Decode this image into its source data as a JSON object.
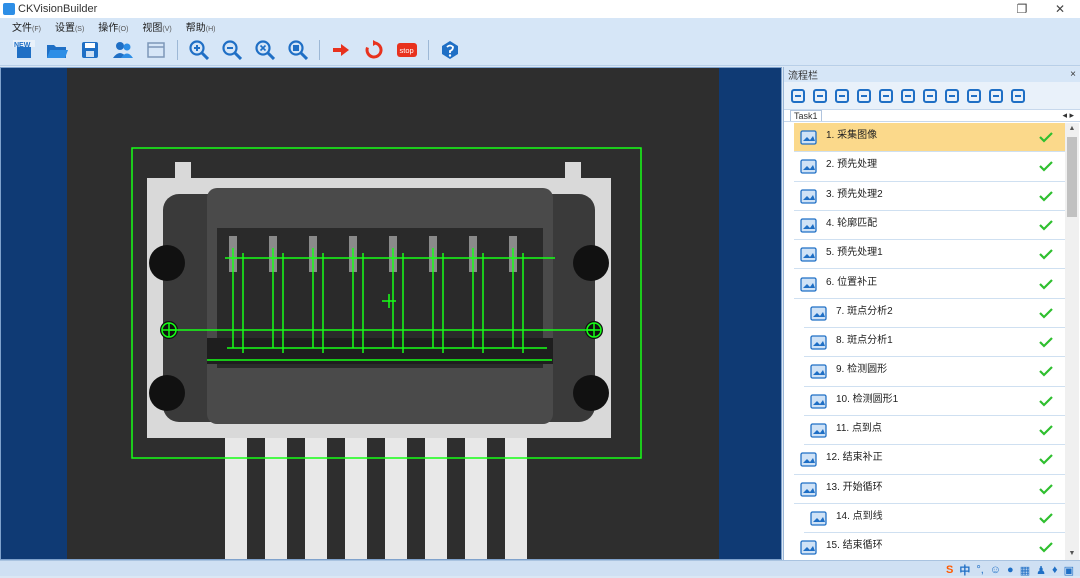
{
  "app": {
    "title": "CKVisionBuilder"
  },
  "window": {
    "restore_glyph": "❐",
    "close_glyph": "✕"
  },
  "menu": [
    {
      "label": "文件",
      "hint": "(F)"
    },
    {
      "label": "设置",
      "hint": "(S)"
    },
    {
      "label": "操作",
      "hint": "(O)"
    },
    {
      "label": "视图",
      "hint": "(V)"
    },
    {
      "label": "帮助",
      "hint": "(H)"
    }
  ],
  "toolbar": {
    "new_label": "NEW",
    "stop_label": "stop",
    "icons": [
      "new-icon",
      "open-folder-icon",
      "save-icon",
      "users-icon",
      "panel-icon",
      "zoom-in-icon",
      "zoom-out-icon",
      "zoom-fit-icon",
      "zoom-reset-icon",
      "run-once-icon",
      "run-loop-icon",
      "stop-icon",
      "help-icon"
    ]
  },
  "panel": {
    "title": "流程栏",
    "close": "×",
    "task_tab": "Task1",
    "nav": "◂ ▸",
    "tools": [
      "insert-before-icon",
      "insert-after-icon",
      "insert-child-icon",
      "split-icon",
      "edit-icon",
      "copy-icon",
      "paste-icon",
      "delete-icon",
      "run-step-icon",
      "run-from-icon",
      "run-all-icon"
    ]
  },
  "steps": [
    {
      "label": "1. 采集图像",
      "icon": "camera-image-icon",
      "selected": true,
      "indent": false,
      "status": "ok"
    },
    {
      "label": "2. 预先处理",
      "icon": "preprocess-icon",
      "selected": false,
      "indent": false,
      "status": "ok"
    },
    {
      "label": "3. 预先处理2",
      "icon": "preprocess-icon",
      "selected": false,
      "indent": false,
      "status": "ok"
    },
    {
      "label": "4. 轮廓匹配",
      "icon": "contour-match-icon",
      "selected": false,
      "indent": false,
      "status": "ok"
    },
    {
      "label": "5. 预先处理1",
      "icon": "preprocess-icon",
      "selected": false,
      "indent": false,
      "status": "ok"
    },
    {
      "label": "6. 位置补正",
      "icon": "position-correct-icon",
      "selected": false,
      "indent": false,
      "status": "ok"
    },
    {
      "label": "7. 斑点分析2",
      "icon": "blob-analysis-icon",
      "selected": false,
      "indent": true,
      "status": "ok"
    },
    {
      "label": "8. 斑点分析1",
      "icon": "blob-analysis-icon",
      "selected": false,
      "indent": true,
      "status": "ok"
    },
    {
      "label": "9. 检测圆形",
      "icon": "circle-detect-icon",
      "selected": false,
      "indent": true,
      "status": "ok"
    },
    {
      "label": "10. 检测圆形1",
      "icon": "circle-detect-icon",
      "selected": false,
      "indent": true,
      "status": "ok"
    },
    {
      "label": "11. 点到点",
      "icon": "point-to-point-icon",
      "selected": false,
      "indent": true,
      "status": "ok"
    },
    {
      "label": "12. 结束补正",
      "icon": "end-correct-icon",
      "selected": false,
      "indent": false,
      "status": "ok"
    },
    {
      "label": "13. 开始循环",
      "icon": "loop-start-icon",
      "selected": false,
      "indent": false,
      "status": "ok"
    },
    {
      "label": "14. 点到线",
      "icon": "point-to-line-icon",
      "selected": false,
      "indent": true,
      "status": "ok"
    },
    {
      "label": "15. 结束循环",
      "icon": "loop-end-icon",
      "selected": false,
      "indent": false,
      "status": "ok"
    }
  ],
  "tray": {
    "ime": "中",
    "items": [
      "ime-logo-icon",
      "punctuation-icon",
      "emoji-icon",
      "mic-icon",
      "keyboard-icon",
      "user-icon",
      "shirt-icon",
      "grid-icon"
    ]
  },
  "colors": {
    "accent": "#2d8ee6",
    "ok": "#2fbf2f",
    "overlay": "#16ff16",
    "selected": "#fbd98b"
  }
}
